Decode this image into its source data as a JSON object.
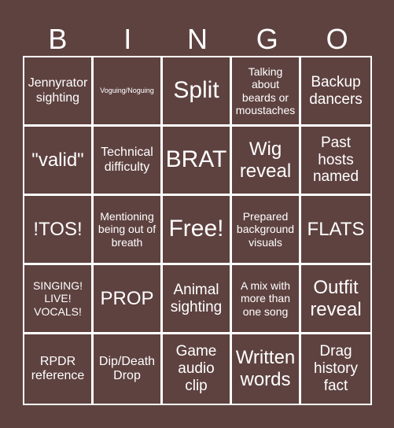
{
  "header": {
    "letters": [
      "B",
      "I",
      "N",
      "G",
      "O"
    ]
  },
  "colors": {
    "background": "#5e4240",
    "lines": "#ffffff",
    "text": "#ffffff"
  },
  "cells": [
    [
      "Jennyrator sighting",
      "Voguing/Noguing",
      "Split",
      "Talking about beards or moustaches",
      "Backup dancers"
    ],
    [
      "\"valid\"",
      "Technical difficulty",
      "BRAT",
      "Wig reveal",
      "Past hosts named"
    ],
    [
      "!TOS!",
      "Mentioning being out of breath",
      "Free!",
      "Prepared background visuals",
      "FLATS"
    ],
    [
      "SINGING! LIVE! VOCALS!",
      "PROP",
      "Animal sighting",
      "A mix with more than one song",
      "Outfit reveal"
    ],
    [
      "RPDR reference",
      "Dip/Death Drop",
      "Game audio clip",
      "Written words",
      "Drag history fact"
    ]
  ]
}
